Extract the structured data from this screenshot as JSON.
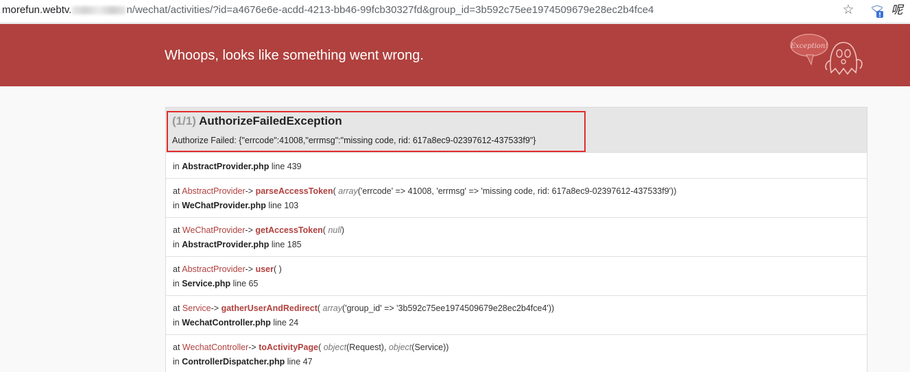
{
  "browser": {
    "url_host": "morefun.webtv.",
    "url_suffix": "n/wechat/activities/?id=a4676e6e-acdd-4213-bb46-99fcb30327fd&group_id=3b592c75ee1974509679e28ec2b4fce4",
    "extension_text": "呢"
  },
  "header": {
    "title": "Whoops, looks like something went wrong.",
    "logo_text": "Exception!"
  },
  "exception": {
    "counter": "(1/1)",
    "name": "AuthorizeFailedException",
    "message": "Authorize Failed: {\"errcode\":41008,\"errmsg\":\"missing code, rid: 617a8ec9-02397612-437533f9\"}"
  },
  "trace": {
    "first": {
      "in": "in",
      "file": "AbstractProvider.php",
      "line_word": "line",
      "line": "439"
    },
    "frames": [
      {
        "at": "at",
        "cls": "AbstractProvider",
        "arrow": "->",
        "method": "parseAccessToken",
        "open": "(",
        "kw": "array",
        "args": "('errcode' => 41008, 'errmsg' => 'missing code, rid: 617a8ec9-02397612-437533f9'))",
        "in": "in",
        "file": "WeChatProvider.php",
        "line_word": "line",
        "line": "103"
      },
      {
        "at": "at",
        "cls": "WeChatProvider",
        "arrow": "->",
        "method": "getAccessToken",
        "open": "(",
        "kw": "null",
        "args": ")",
        "in": "in",
        "file": "AbstractProvider.php",
        "line_word": "line",
        "line": "185"
      },
      {
        "at": "at",
        "cls": "AbstractProvider",
        "arrow": "->",
        "method": "user",
        "open": "(",
        "kw": "",
        "args": ")",
        "in": "in",
        "file": "Service.php",
        "line_word": "line",
        "line": "65"
      },
      {
        "at": "at",
        "cls": "Service",
        "arrow": "->",
        "method": "gatherUserAndRedirect",
        "open": "(",
        "kw": "array",
        "args": "('group_id' => '3b592c75ee1974509679e28ec2b4fce4'))",
        "in": "in",
        "file": "WechatController.php",
        "line_word": "line",
        "line": "24"
      },
      {
        "at": "at",
        "cls": "WechatController",
        "arrow": "->",
        "method": "toActivityPage",
        "open": "(",
        "kw": "object",
        "args": "(Request), ",
        "kw2": "object",
        "args2": "(Service))",
        "in": "in",
        "file": "ControllerDispatcher.php",
        "line_word": "line",
        "line": "47"
      }
    ]
  },
  "colors": {
    "header_bg": "#b0413e",
    "accent": "#b0413e",
    "highlight": "#e32c2c"
  }
}
